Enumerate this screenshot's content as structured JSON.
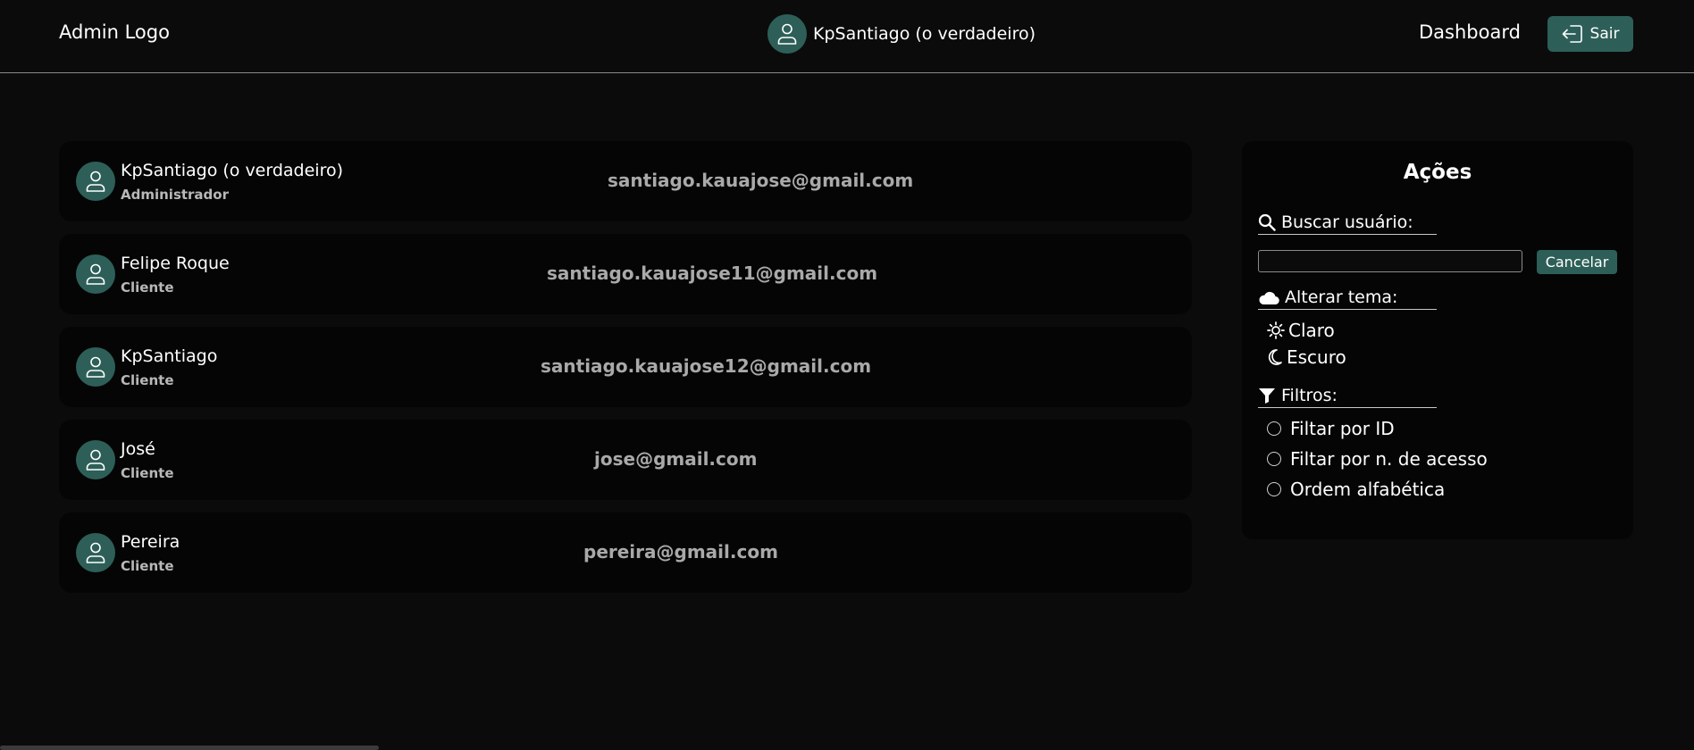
{
  "header": {
    "logo": "Admin Logo",
    "current_user": "KpSantiago (o verdadeiro)",
    "dashboard_label": "Dashboard",
    "exit_label": "Sair"
  },
  "users": [
    {
      "name": "KpSantiago (o verdadeiro)",
      "role": "Administrador",
      "email": "santiago.kauajose@gmail.com"
    },
    {
      "name": "Felipe Roque",
      "role": "Cliente",
      "email": "santiago.kauajose11@gmail.com"
    },
    {
      "name": "KpSantiago",
      "role": "Cliente",
      "email": "santiago.kauajose12@gmail.com"
    },
    {
      "name": "José",
      "role": "Cliente",
      "email": "jose@gmail.com"
    },
    {
      "name": "Pereira",
      "role": "Cliente",
      "email": "pereira@gmail.com"
    }
  ],
  "actions": {
    "title": "Ações",
    "search_label": "Buscar usuário:",
    "search_value": "",
    "cancel_label": "Cancelar",
    "theme_label": "Alterar tema:",
    "theme_light": "Claro",
    "theme_dark": "Escuro",
    "filters_label": "Filtros:",
    "filters": [
      "Filtar por ID",
      "Filtar por n. de acesso",
      "Ordem alfabética"
    ]
  },
  "colors": {
    "accent": "#2d5f58",
    "background": "#0b0b0b",
    "card": "#050505",
    "muted_text": "#a9a9a9"
  }
}
